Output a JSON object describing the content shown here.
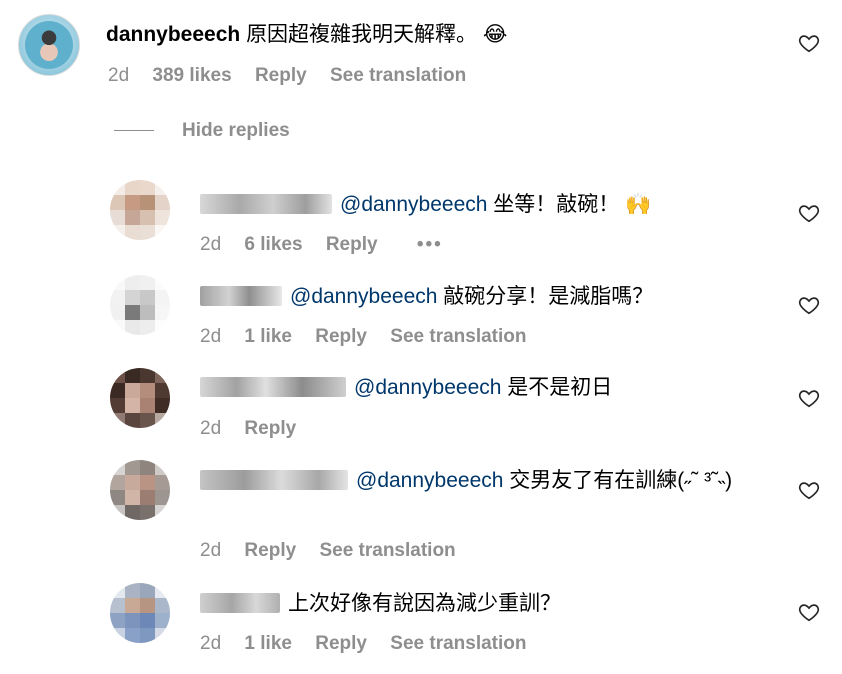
{
  "main_comment": {
    "username": "dannybeeech",
    "text": "原因超複雜我明天解釋。",
    "emoji": "😂",
    "time": "2d",
    "likes": "389 likes",
    "reply": "Reply",
    "translate": "See translation"
  },
  "hide_replies": "Hide replies",
  "replies": [
    {
      "mention": "@dannybeeech",
      "text": "坐等！敲碗！",
      "emoji": "🙌",
      "time": "2d",
      "likes": "6 likes",
      "reply": "Reply",
      "more": "•••"
    },
    {
      "mention": "@dannybeeech",
      "text": "敲碗分享！是減脂嗎？",
      "time": "2d",
      "likes": "1 like",
      "reply": "Reply",
      "translate": "See translation"
    },
    {
      "mention": "@dannybeeech",
      "text": "是不是初日",
      "time": "2d",
      "reply": "Reply"
    },
    {
      "mention": "@dannybeeech",
      "text": "交男友了有在訓練(˶˜ ³˜˵)",
      "time": "2d",
      "reply": "Reply",
      "translate": "See translation"
    },
    {
      "text": "上次好像有說因為減少重訓？",
      "time": "2d",
      "likes": "1 like",
      "reply": "Reply",
      "translate": "See translation"
    }
  ],
  "icons": {
    "heart": "heart-outline-icon"
  },
  "colors": {
    "mention": "#00376b",
    "meta": "#8e8e8e"
  }
}
